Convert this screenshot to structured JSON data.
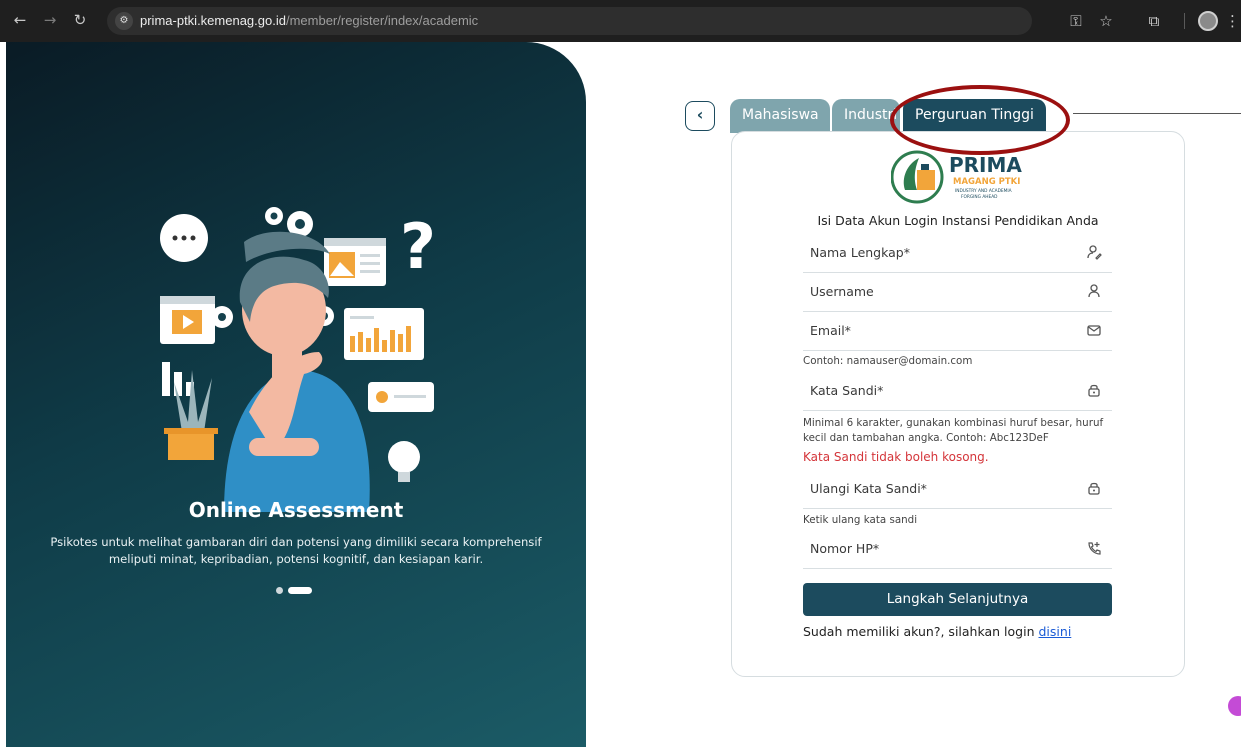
{
  "browser": {
    "url_host": "prima-ptki.kemenag.go.id",
    "url_path": "/member/register/index/academic"
  },
  "hero": {
    "title": "Online Assessment",
    "description": "Psikotes untuk melihat gambaran diri dan potensi yang dimiliki secara komprehensif meliputi minat, kepribadian, potensi kognitif, dan kesiapan karir.",
    "illustration_question_mark": "?"
  },
  "tabs": [
    {
      "label": "Mahasiswa",
      "active": false
    },
    {
      "label": "Industri",
      "active": false
    },
    {
      "label": "Perguruan Tinggi",
      "active": true
    }
  ],
  "logo": {
    "title": "PRIMA",
    "subtitle": "MAGANG PTKI",
    "tagline_1": "INDUSTRY AND ACADEMIA",
    "tagline_2": "FORGING AHEAD"
  },
  "form": {
    "title": "Isi Data Akun Login Instansi Pendidikan Anda",
    "full_name": {
      "placeholder": "Nama Lengkap*",
      "icon": "user-edit-icon"
    },
    "username": {
      "placeholder": "Username",
      "icon": "user-icon"
    },
    "email": {
      "placeholder": "Email*",
      "icon": "mail-icon",
      "hint": "Contoh: namauser@domain.com"
    },
    "password": {
      "placeholder": "Kata Sandi*",
      "icon": "lock-icon",
      "hint": "Minimal 6 karakter, gunakan kombinasi huruf besar, huruf kecil dan tambahan angka. Contoh: Abc123DeF",
      "error": "Kata Sandi tidak boleh kosong."
    },
    "confirm_password": {
      "placeholder": "Ulangi Kata Sandi*",
      "icon": "lock-icon",
      "hint": "Ketik ulang kata sandi"
    },
    "phone": {
      "placeholder": "Nomor HP*",
      "icon": "phone-plus-icon"
    },
    "submit_label": "Langkah Selanjutnya",
    "login_prompt": "Sudah memiliki akun?, silahkan login",
    "login_link": "disini"
  },
  "colors": {
    "primary": "#1c4b5e",
    "tab_inactive": "#7fa5ad",
    "error": "#d4353a",
    "annotation": "#9b1010",
    "link": "#1a5bd6"
  }
}
